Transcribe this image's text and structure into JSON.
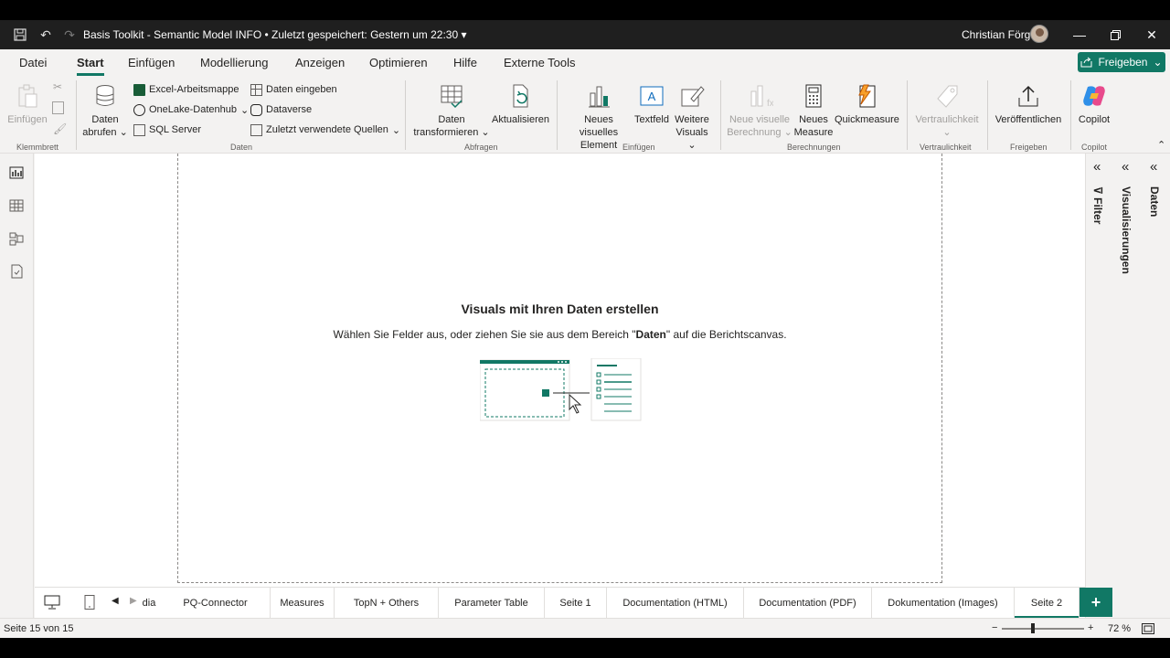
{
  "titlebar": {
    "title": "Basis Toolkit - Semantic Model INFO • Zuletzt gespeichert: Gestern um 22:30",
    "user": "Christian Förg"
  },
  "menu": {
    "tabs": [
      "Datei",
      "Start",
      "Einfügen",
      "Modellierung",
      "Anzeigen",
      "Optimieren",
      "Hilfe",
      "Externe Tools"
    ],
    "active": "Start",
    "share_label": "Freigeben"
  },
  "ribbon": {
    "groups": [
      "Klemmbrett",
      "Daten",
      "Abfragen",
      "Einfügen",
      "Berechnungen",
      "Vertraulichkeit",
      "Freigeben",
      "Copilot"
    ],
    "paste": "Einfügen",
    "get_data": [
      "Daten",
      "abrufen"
    ],
    "excel": "Excel-Arbeitsmappe",
    "onelake": "OneLake-Datenhub",
    "sqlserver": "SQL Server",
    "enter_data": "Daten eingeben",
    "dataverse": "Dataverse",
    "recent_sources": "Zuletzt verwendete Quellen",
    "transform": [
      "Daten",
      "transformieren"
    ],
    "refresh": "Aktualisieren",
    "new_visual": [
      "Neues visuelles",
      "Element"
    ],
    "textbox": "Textfeld",
    "more_visuals": [
      "Weitere",
      "Visuals"
    ],
    "new_visual_calc": [
      "Neue visuelle",
      "Berechnung"
    ],
    "new_measure": [
      "Neues",
      "Measure"
    ],
    "quick_measure": "Quickmeasure",
    "sensitivity": "Vertraulichkeit",
    "publish": "Veröffentlichen",
    "copilot": "Copilot"
  },
  "canvas": {
    "headline": "Visuals mit Ihren Daten erstellen",
    "sub_before": "Wählen Sie Felder aus, oder ziehen Sie sie aus dem Bereich \"",
    "sub_bold": "Daten",
    "sub_after": "\" auf die Berichtscanvas."
  },
  "panes": {
    "filter": "Filter",
    "visualizations": "Visualisierungen",
    "data": "Daten"
  },
  "pagetabs": {
    "items": [
      "dia",
      "PQ-Connector",
      "Measures",
      "TopN + Others",
      "Parameter Table",
      "Seite 1",
      "Documentation (HTML)",
      "Documentation (PDF)",
      "Dokumentation (Images)",
      "Seite 2"
    ],
    "active": "Seite 2",
    "add_label": "+"
  },
  "status": {
    "page": "Seite 15 von 15",
    "zoom": "72 %",
    "zoom_fraction": 0.36
  },
  "colors": {
    "accent": "#117865",
    "titlebar": "#1f1f1f"
  }
}
